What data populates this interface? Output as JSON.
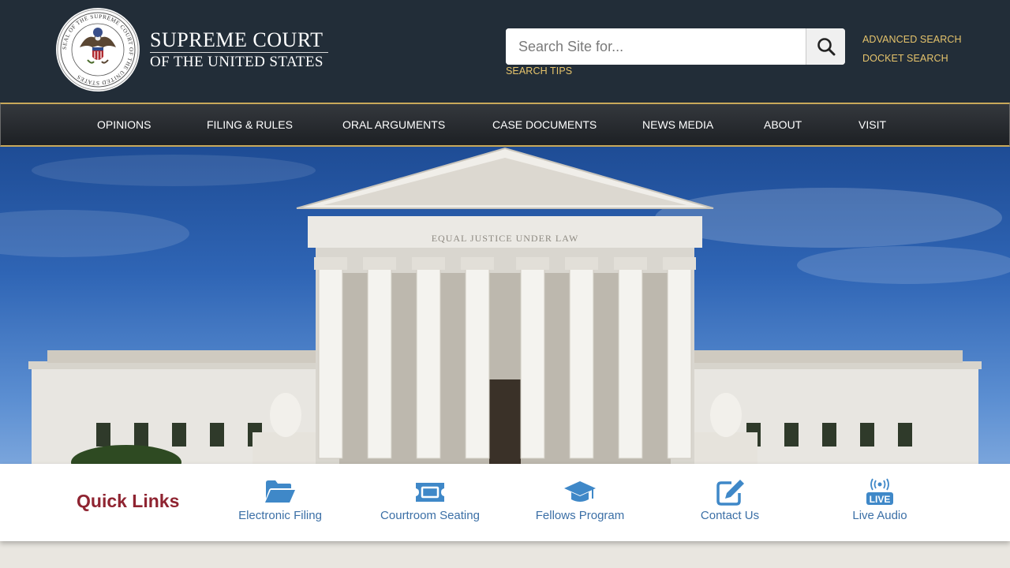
{
  "header": {
    "seal_text": "SEAL OF THE SUPREME COURT OF THE UNITED STATES",
    "title_line1": "SUPREME COURT",
    "title_line2": "OF THE UNITED STATES",
    "search": {
      "placeholder": "Search Site for...",
      "value": "",
      "button_icon": "search-icon",
      "tips_label": "SEARCH TIPS"
    },
    "links": {
      "advanced_search": "ADVANCED SEARCH",
      "docket_search": "DOCKET SEARCH"
    },
    "colors": {
      "background": "#222d38",
      "accent_gold": "#e6c46c"
    }
  },
  "nav": {
    "items": [
      {
        "label": "OPINIONS"
      },
      {
        "label": "FILING & RULES"
      },
      {
        "label": "ORAL ARGUMENTS"
      },
      {
        "label": "CASE DOCUMENTS"
      },
      {
        "label": "NEWS MEDIA"
      },
      {
        "label": "ABOUT"
      },
      {
        "label": "VISIT"
      }
    ]
  },
  "hero": {
    "inscription": "EQUAL JUSTICE UNDER LAW"
  },
  "quick_links": {
    "title": "Quick Links",
    "items": [
      {
        "label": "Electronic Filing",
        "icon": "folder-open-icon"
      },
      {
        "label": "Courtroom Seating",
        "icon": "ticket-icon"
      },
      {
        "label": "Fellows Program",
        "icon": "graduation-cap-icon"
      },
      {
        "label": "Contact Us",
        "icon": "edit-icon"
      },
      {
        "label": "Live Audio",
        "icon": "live-broadcast-icon",
        "badge": "LIVE"
      }
    ],
    "colors": {
      "title": "#8f2431",
      "link": "#3b6fa6",
      "icon": "#3f88c8"
    }
  }
}
